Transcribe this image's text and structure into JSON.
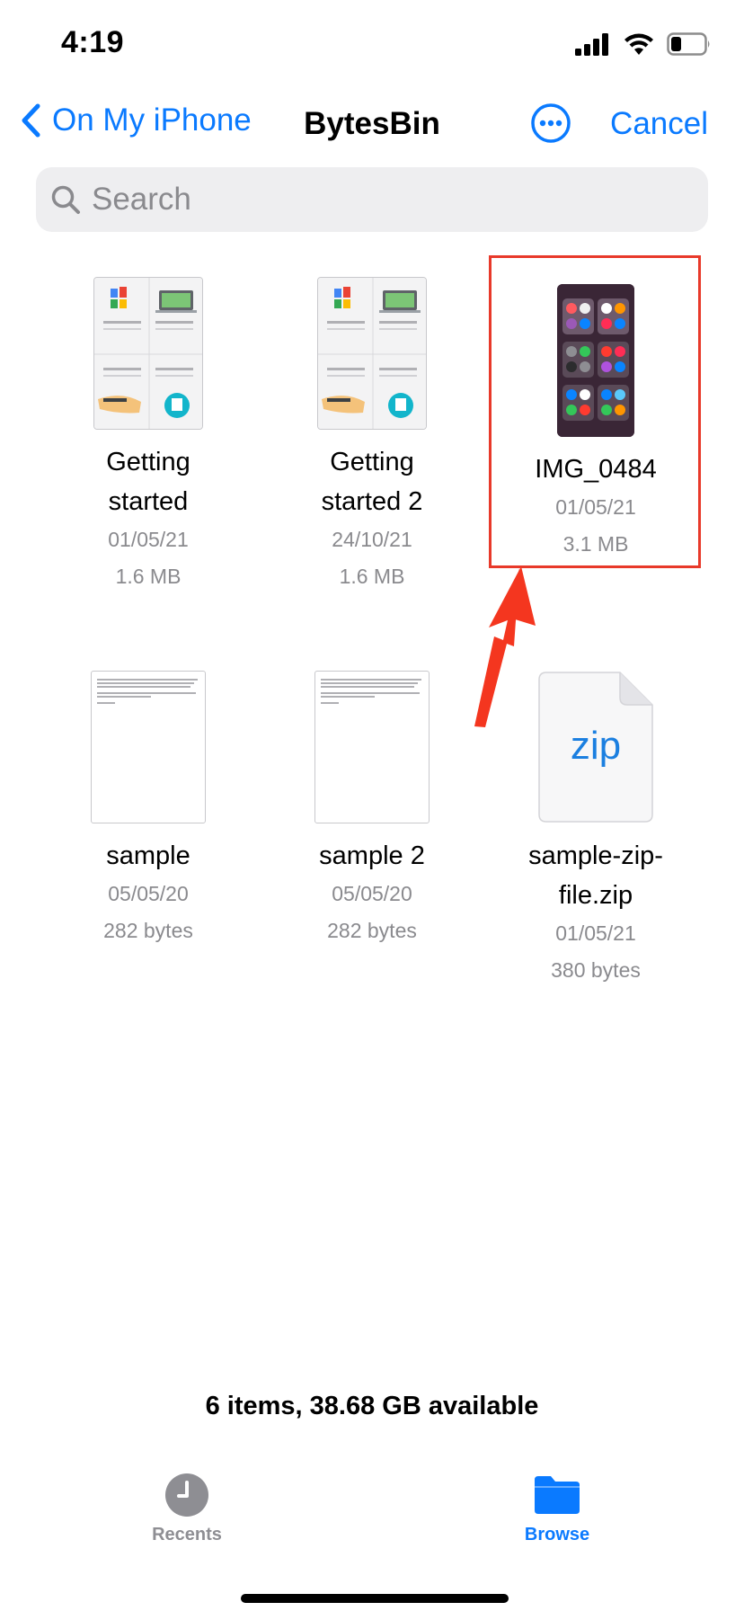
{
  "status": {
    "time": "4:19",
    "icons": [
      "cellular-signal-icon",
      "wifi-icon",
      "battery-icon"
    ],
    "battery_level": 0.3
  },
  "nav": {
    "back_label": "On My iPhone",
    "title": "BytesBin",
    "cancel_label": "Cancel",
    "more_icon": "ellipsis-circle-icon"
  },
  "search": {
    "placeholder": "Search"
  },
  "files": [
    {
      "name_lines": [
        "Getting",
        "started"
      ],
      "date": "01/05/21",
      "size": "1.6 MB",
      "kind": "guide"
    },
    {
      "name_lines": [
        "Getting",
        "started 2"
      ],
      "date": "24/10/21",
      "size": "1.6 MB",
      "kind": "guide"
    },
    {
      "name_lines": [
        "IMG_0484"
      ],
      "date": "01/05/21",
      "size": "3.1 MB",
      "kind": "image",
      "highlighted": true
    },
    {
      "name_lines": [
        "sample"
      ],
      "date": "05/05/20",
      "size": "282 bytes",
      "kind": "text"
    },
    {
      "name_lines": [
        "sample 2"
      ],
      "date": "05/05/20",
      "size": "282 bytes",
      "kind": "text"
    },
    {
      "name_lines": [
        "sample-zip-",
        "file.zip"
      ],
      "date": "01/05/21",
      "size": "380 bytes",
      "kind": "zip",
      "thumb_label": "zip"
    }
  ],
  "footer": {
    "summary": "6 items, 38.68 GB available"
  },
  "tabs": [
    {
      "label": "Recents",
      "icon": "clock-icon",
      "active": false
    },
    {
      "label": "Browse",
      "icon": "folder-icon",
      "active": true
    }
  ],
  "colors": {
    "accent": "#0a7aff",
    "annotation": "#e8392a",
    "secondary_text": "#8a8a8e",
    "inactive_tab": "#8e8e93"
  }
}
